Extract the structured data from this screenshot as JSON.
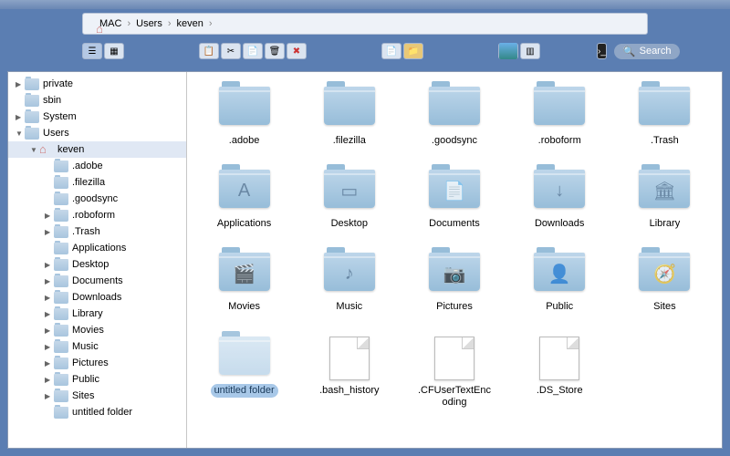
{
  "breadcrumb": [
    {
      "label": "MAC",
      "icon": "home"
    },
    {
      "label": "Users",
      "icon": "folder"
    },
    {
      "label": "keven",
      "icon": "folder"
    }
  ],
  "toolbar": {
    "view_buttons": [
      "list",
      "grid"
    ],
    "action_icons": [
      "copy",
      "cut",
      "paste",
      "trash",
      "delete-x"
    ],
    "new_icons": [
      "new-file",
      "new-folder"
    ],
    "misc_icons": [
      "picture",
      "window-list"
    ],
    "terminal_icon": "terminal",
    "search_placeholder": "Search"
  },
  "sidebar": [
    {
      "label": "private",
      "depth": 0,
      "arrow": "right",
      "icon": "folder"
    },
    {
      "label": "sbin",
      "depth": 0,
      "arrow": "",
      "icon": "folder"
    },
    {
      "label": "System",
      "depth": 0,
      "arrow": "right",
      "icon": "folder"
    },
    {
      "label": "Users",
      "depth": 0,
      "arrow": "down",
      "icon": "folder"
    },
    {
      "label": "keven",
      "depth": 1,
      "arrow": "down",
      "icon": "home",
      "selected": true
    },
    {
      "label": ".adobe",
      "depth": 2,
      "arrow": "",
      "icon": "folder"
    },
    {
      "label": ".filezilla",
      "depth": 2,
      "arrow": "",
      "icon": "folder"
    },
    {
      "label": ".goodsync",
      "depth": 2,
      "arrow": "",
      "icon": "folder"
    },
    {
      "label": ".roboform",
      "depth": 2,
      "arrow": "right",
      "icon": "folder"
    },
    {
      "label": ".Trash",
      "depth": 2,
      "arrow": "right",
      "icon": "folder"
    },
    {
      "label": "Applications",
      "depth": 2,
      "arrow": "",
      "icon": "folder"
    },
    {
      "label": "Desktop",
      "depth": 2,
      "arrow": "right",
      "icon": "folder"
    },
    {
      "label": "Documents",
      "depth": 2,
      "arrow": "right",
      "icon": "folder"
    },
    {
      "label": "Downloads",
      "depth": 2,
      "arrow": "right",
      "icon": "folder"
    },
    {
      "label": "Library",
      "depth": 2,
      "arrow": "right",
      "icon": "folder"
    },
    {
      "label": "Movies",
      "depth": 2,
      "arrow": "right",
      "icon": "folder"
    },
    {
      "label": "Music",
      "depth": 2,
      "arrow": "right",
      "icon": "folder"
    },
    {
      "label": "Pictures",
      "depth": 2,
      "arrow": "right",
      "icon": "folder"
    },
    {
      "label": "Public",
      "depth": 2,
      "arrow": "right",
      "icon": "folder"
    },
    {
      "label": "Sites",
      "depth": 2,
      "arrow": "right",
      "icon": "folder"
    },
    {
      "label": "untitled folder",
      "depth": 2,
      "arrow": "",
      "icon": "folder"
    }
  ],
  "grid": [
    {
      "label": ".adobe",
      "type": "folder",
      "glyph": ""
    },
    {
      "label": ".filezilla",
      "type": "folder",
      "glyph": ""
    },
    {
      "label": ".goodsync",
      "type": "folder",
      "glyph": ""
    },
    {
      "label": ".roboform",
      "type": "folder",
      "glyph": ""
    },
    {
      "label": ".Trash",
      "type": "folder",
      "glyph": ""
    },
    {
      "label": "Applications",
      "type": "folder",
      "glyph": "A"
    },
    {
      "label": "Desktop",
      "type": "folder",
      "glyph": "▭"
    },
    {
      "label": "Documents",
      "type": "folder",
      "glyph": "📄"
    },
    {
      "label": "Downloads",
      "type": "folder",
      "glyph": "↓"
    },
    {
      "label": "Library",
      "type": "folder",
      "glyph": "🏛"
    },
    {
      "label": "Movies",
      "type": "folder",
      "glyph": "🎬"
    },
    {
      "label": "Music",
      "type": "folder",
      "glyph": "♪"
    },
    {
      "label": "Pictures",
      "type": "folder",
      "glyph": "📷"
    },
    {
      "label": "Public",
      "type": "folder",
      "glyph": "👤"
    },
    {
      "label": "Sites",
      "type": "folder",
      "glyph": "🧭"
    },
    {
      "label": "untitled folder",
      "type": "folder",
      "glyph": "",
      "highlighted": true
    },
    {
      "label": ".bash_history",
      "type": "file"
    },
    {
      "label": ".CFUserTextEncoding",
      "type": "file"
    },
    {
      "label": ".DS_Store",
      "type": "file"
    }
  ],
  "colors": {
    "accent": "#5b7eb2",
    "folder": "#a8c5de"
  }
}
